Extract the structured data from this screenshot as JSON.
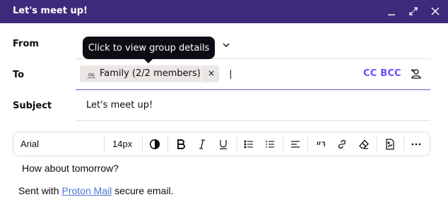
{
  "window": {
    "title": "Let's meet up!",
    "controls": [
      "minimize-icon",
      "maximize-icon",
      "close-icon"
    ]
  },
  "from": {
    "label": "From"
  },
  "tooltip": {
    "text": "Click to view group details"
  },
  "to": {
    "label": "To",
    "chip": {
      "label": "Family (2/2 members)",
      "icon": "group-icon",
      "remove": "×"
    },
    "cc_bcc": "CC BCC",
    "add_contact_icon": "add-contact-icon"
  },
  "subject": {
    "label": "Subject",
    "value": "Let's meet up!"
  },
  "toolbar": {
    "font": "Arial",
    "size": "14px",
    "buttons": [
      "contrast-icon",
      "bold-icon",
      "italic-icon",
      "underline-icon",
      "bulleted-list-icon",
      "numbered-list-icon",
      "align-icon",
      "quote-icon",
      "link-icon",
      "clear-format-icon",
      "insert-image-icon",
      "more-icon"
    ]
  },
  "body": {
    "line1": "How about tomorrow?",
    "signature_prefix": "Sent with ",
    "signature_link": "Proton Mail",
    "signature_suffix": " secure email."
  },
  "colors": {
    "header": "#3c2a7a",
    "accent": "#6d4aff",
    "link": "#4a78d6"
  }
}
